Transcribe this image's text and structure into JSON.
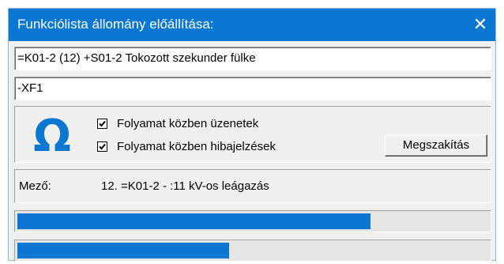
{
  "window": {
    "title": "Funkciólista állomány előállítása:",
    "close_glyph": "✕"
  },
  "fields": {
    "path": "=K01-2 (12) +S01-2 Tokozott szekunder fülke",
    "code": "-XF1"
  },
  "options": {
    "icon": "omega-icon",
    "icon_color": "#0a78d2",
    "messages_label": "Folyamat közben üzenetek",
    "messages_checked": true,
    "errors_label": "Folyamat közben hibajelzések",
    "errors_checked": true,
    "cancel_label": "Megszakítás"
  },
  "status": {
    "label": "Mező:",
    "value": "12. =K01-2  -  :11 kV-os leágazás"
  },
  "progress": {
    "color": "#0a78d2",
    "bar1_fraction": 0.75,
    "bar2_fraction": 0.45
  }
}
